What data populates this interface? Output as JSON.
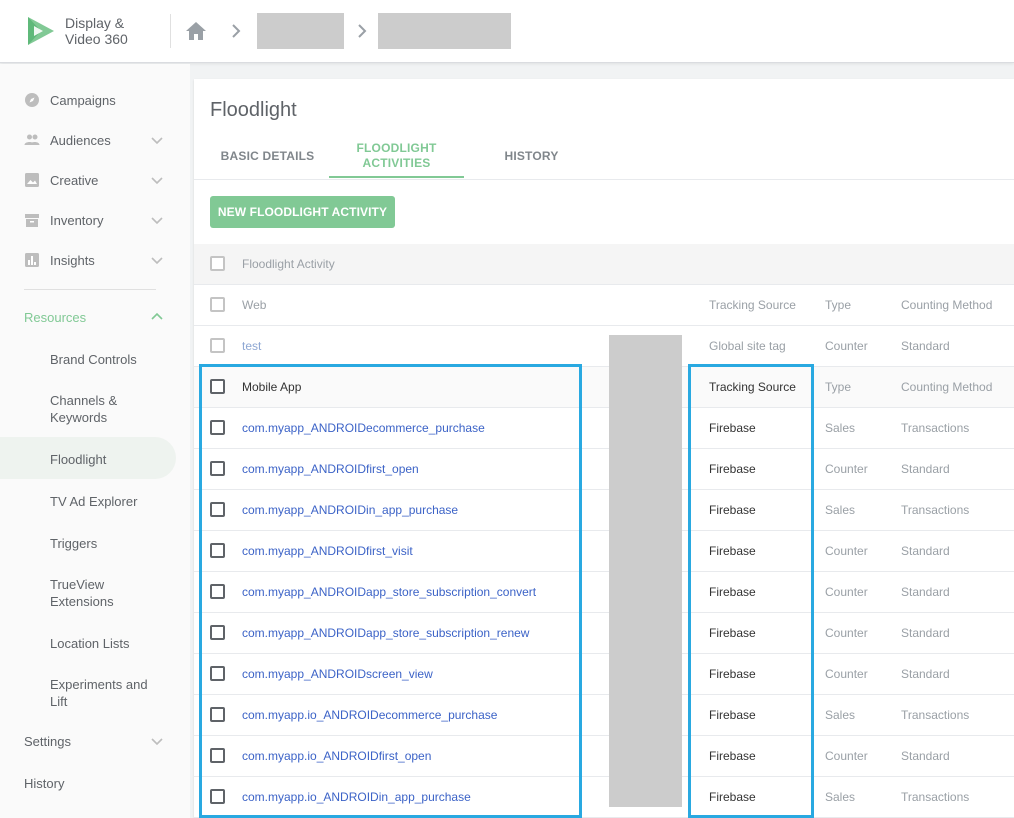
{
  "app": {
    "name": "Display & Video 360"
  },
  "header": {
    "breadcrumb": [
      "home-icon"
    ]
  },
  "sidebar": {
    "items": [
      {
        "label": "Campaigns",
        "icon": "compass-icon",
        "expandable": false
      },
      {
        "label": "Audiences",
        "icon": "people-icon",
        "expandable": true
      },
      {
        "label": "Creative",
        "icon": "image-icon",
        "expandable": true
      },
      {
        "label": "Inventory",
        "icon": "inventory-icon",
        "expandable": true
      },
      {
        "label": "Insights",
        "icon": "chart-icon",
        "expandable": true
      }
    ],
    "resources_label": "Resources",
    "resources_sub": [
      "Brand Controls",
      "Channels & Keywords",
      "Floodlight",
      "TV Ad Explorer",
      "Triggers",
      "TrueView Extensions",
      "Location Lists",
      "Experiments and Lift"
    ],
    "active_item": "Floodlight",
    "settings_label": "Settings",
    "history_label": "History"
  },
  "page": {
    "title": "Floodlight",
    "tabs": [
      {
        "label": "BASIC DETAILS",
        "active": false
      },
      {
        "label": "FLOODLIGHT ACTIVITIES",
        "active": true
      },
      {
        "label": "HISTORY",
        "active": false
      }
    ],
    "new_button_label": "NEW FLOODLIGHT ACTIVITY"
  },
  "table": {
    "header": {
      "name": "Floodlight Activity"
    },
    "web_group": {
      "name": "Web",
      "source": "Tracking Source",
      "type": "Type",
      "counting": "Counting Method"
    },
    "web_rows": [
      {
        "name": "test",
        "source": "Global site tag",
        "type": "Counter",
        "counting": "Standard"
      }
    ],
    "app_group": {
      "name": "Mobile App",
      "source": "Tracking Source",
      "type": "Type",
      "counting": "Counting Method"
    },
    "app_rows": [
      {
        "name": "com.myapp_ANDROIDecommerce_purchase",
        "source": "Firebase",
        "type": "Sales",
        "counting": "Transactions"
      },
      {
        "name": "com.myapp_ANDROIDfirst_open",
        "source": "Firebase",
        "type": "Counter",
        "counting": "Standard"
      },
      {
        "name": "com.myapp_ANDROIDin_app_purchase",
        "source": "Firebase",
        "type": "Sales",
        "counting": "Transactions"
      },
      {
        "name": "com.myapp_ANDROIDfirst_visit",
        "source": "Firebase",
        "type": "Counter",
        "counting": "Standard"
      },
      {
        "name": "com.myapp_ANDROIDapp_store_subscription_convert",
        "source": "Firebase",
        "type": "Counter",
        "counting": "Standard"
      },
      {
        "name": "com.myapp_ANDROIDapp_store_subscription_renew",
        "source": "Firebase",
        "type": "Counter",
        "counting": "Standard"
      },
      {
        "name": "com.myapp_ANDROIDscreen_view",
        "source": "Firebase",
        "type": "Counter",
        "counting": "Standard"
      },
      {
        "name": "com.myapp.io_ANDROIDecommerce_purchase",
        "source": "Firebase",
        "type": "Sales",
        "counting": "Transactions"
      },
      {
        "name": "com.myapp.io_ANDROIDfirst_open",
        "source": "Firebase",
        "type": "Counter",
        "counting": "Standard"
      },
      {
        "name": "com.myapp.io_ANDROIDin_app_purchase",
        "source": "Firebase",
        "type": "Sales",
        "counting": "Transactions"
      }
    ]
  },
  "colors": {
    "accent": "#81c995",
    "link": "#3c63c7",
    "highlight": "#29a9e1",
    "redaction": "#cccccc"
  }
}
